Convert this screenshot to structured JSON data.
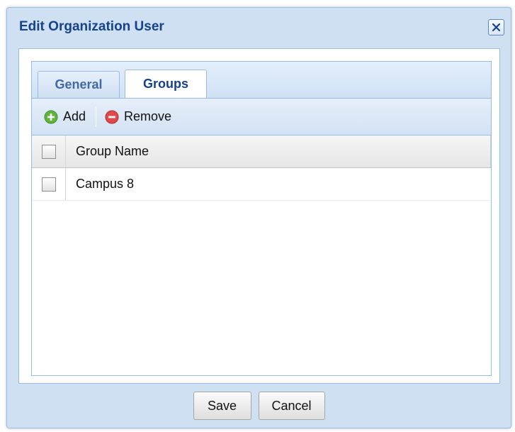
{
  "dialog": {
    "title": "Edit Organization User",
    "close_icon": "close-icon"
  },
  "tabs": [
    {
      "label": "General",
      "active": false
    },
    {
      "label": "Groups",
      "active": true
    }
  ],
  "toolbar": {
    "add_label": "Add",
    "add_icon": "add-icon",
    "remove_label": "Remove",
    "remove_icon": "remove-icon"
  },
  "grid": {
    "columns": [
      "Group Name"
    ],
    "rows": [
      {
        "group_name": "Campus 8",
        "checked": false
      }
    ],
    "select_all_checked": false
  },
  "footer": {
    "save_label": "Save",
    "cancel_label": "Cancel"
  },
  "colors": {
    "title_text": "#15428b",
    "border": "#99bbe8",
    "window_bg": "#cfe0f3",
    "add_icon_green": "#5fb53d",
    "remove_icon_red": "#e0494a"
  }
}
